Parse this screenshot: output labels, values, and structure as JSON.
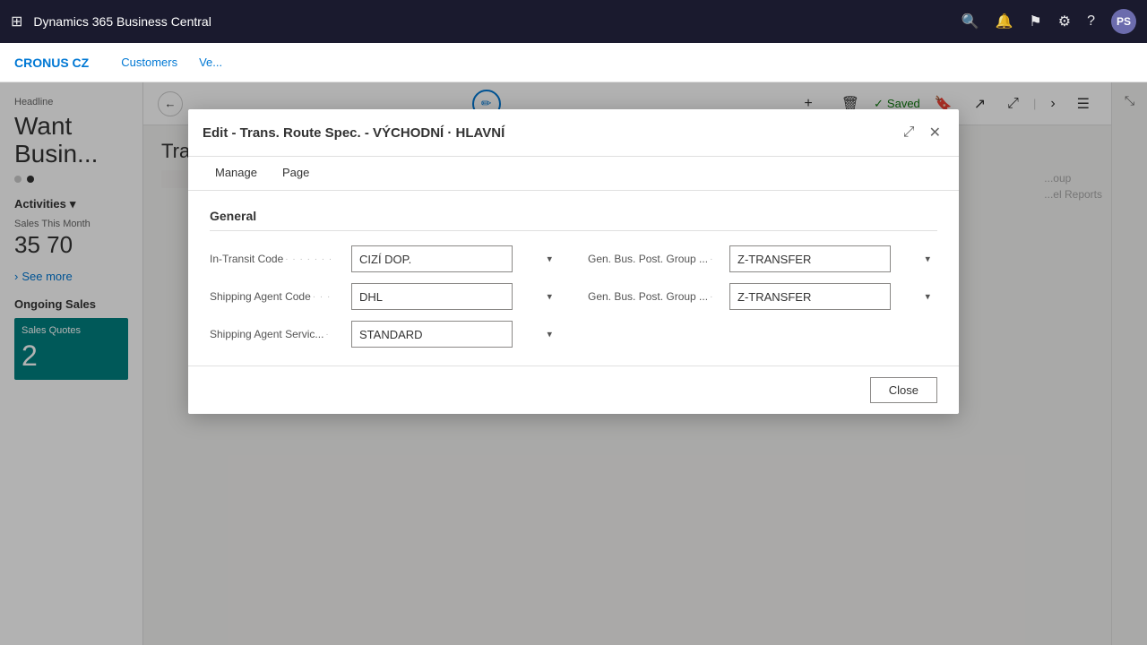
{
  "app": {
    "title": "Dynamics 365 Business Central",
    "avatar": "PS"
  },
  "topnav": {
    "brand": "CRONUS CZ",
    "items": [
      "Customers",
      "Ve..."
    ]
  },
  "toolbar": {
    "saved_label": "Saved",
    "add_label": "+",
    "delete_label": "🗑"
  },
  "page": {
    "title": "Transfer Routes"
  },
  "sidebar": {
    "headline": "Headline",
    "big_text_line1": "Want",
    "big_text_line2": "Busin...",
    "activities_label": "Activities",
    "sales_this_month_label": "Sales This Month",
    "sales_this_month_value": "35 70",
    "see_more_label": "See more",
    "ongoing_sales_label": "Ongoing Sales",
    "sales_quotes_label": "Sales Quotes",
    "sales_quotes_value": "2"
  },
  "modal": {
    "title": "Edit - Trans. Route Spec. - VÝCHODNÍ · HLAVNÍ",
    "tabs": [
      "Manage",
      "Page"
    ],
    "sections": [
      {
        "title": "General",
        "fields": [
          {
            "label": "In-Transit Code",
            "dots": "· · · · · · ·",
            "value": "CIZÍ DOP.",
            "id": "in-transit-code"
          },
          {
            "label": "Gen. Bus. Post. Group ...",
            "dots": "·",
            "value": "Z-TRANSFER",
            "id": "gen-bus-post-group-1"
          },
          {
            "label": "Shipping Agent Code",
            "dots": "· · ·",
            "value": "DHL",
            "id": "shipping-agent-code"
          },
          {
            "label": "Gen. Bus. Post. Group ...",
            "dots": "·",
            "value": "Z-TRANSFER",
            "id": "gen-bus-post-group-2"
          },
          {
            "label": "Shipping Agent Servic...",
            "dots": "·",
            "value": "STANDARD",
            "id": "shipping-agent-service"
          }
        ]
      }
    ],
    "close_button": "Close"
  }
}
